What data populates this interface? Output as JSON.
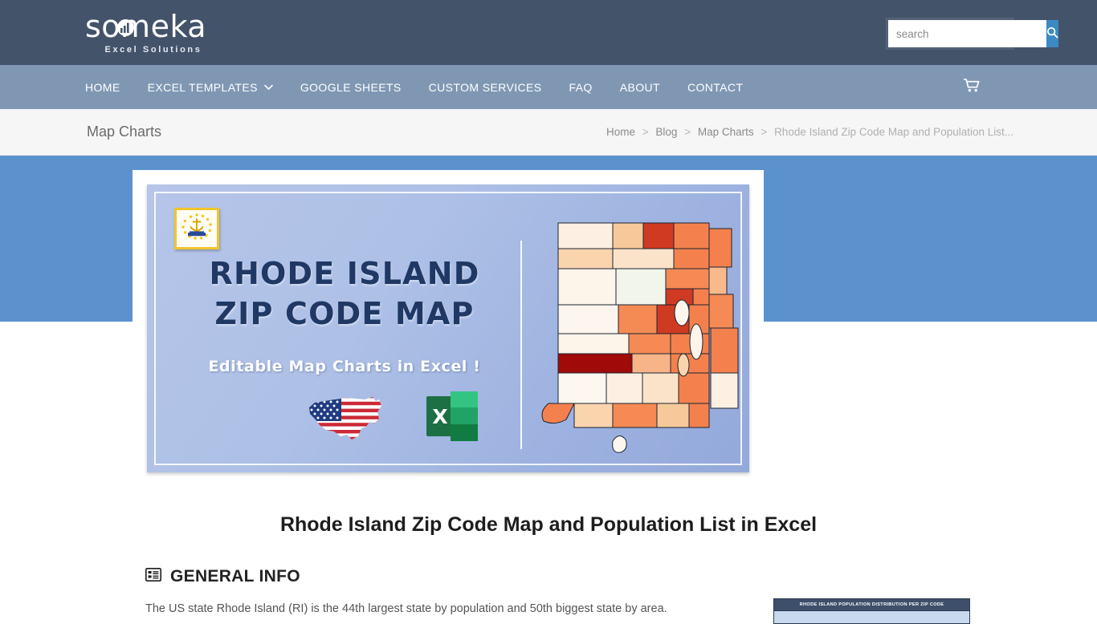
{
  "header": {
    "logo_word": "someka",
    "logo_tagline": "Excel Solutions",
    "logo_badge_icon": "bar-chart-icon"
  },
  "search": {
    "placeholder": "search",
    "value": "",
    "button_icon": "search-icon"
  },
  "nav": {
    "items": [
      {
        "label": "HOME",
        "has_dropdown": false
      },
      {
        "label": "EXCEL TEMPLATES",
        "has_dropdown": true
      },
      {
        "label": "GOOGLE SHEETS",
        "has_dropdown": false
      },
      {
        "label": "CUSTOM SERVICES",
        "has_dropdown": false
      },
      {
        "label": "FAQ",
        "has_dropdown": false
      },
      {
        "label": "ABOUT",
        "has_dropdown": false
      },
      {
        "label": "CONTACT",
        "has_dropdown": false
      }
    ],
    "cart_icon": "shopping-cart-icon",
    "dropdown_icon": "chevron-down-icon"
  },
  "breadcrumb": {
    "page_label": "Map Charts",
    "trail": [
      "Home",
      "Blog",
      "Map Charts"
    ],
    "current": "Rhode Island Zip Code Map and Population List...",
    "separator": ">"
  },
  "hero": {
    "flag_alt": "rhode-island-flag",
    "title_line1": "RHODE ISLAND",
    "title_line2": "ZIP CODE MAP",
    "subtitle": "Editable Map Charts in Excel !",
    "usa_flag_icon": "usa-flag-map-icon",
    "excel_icon": "excel-logo-icon",
    "excel_letter": "X",
    "map_alt": "rhode-island-zip-code-choropleth-map"
  },
  "article": {
    "title": "Rhode Island Zip Code Map and Population List in Excel",
    "section_icon": "list-box-icon",
    "section_title": "GENERAL INFO",
    "paragraph": "The US state Rhode Island (RI) is the 44th largest state by population and 50th biggest state by area."
  },
  "mini_chart": {
    "title": "RHODE ISLAND POPULATION DISTRIBUTION PER ZIP CODE"
  },
  "colors": {
    "header_bg": "#43536a",
    "nav_bg": "#8097b4",
    "band_bg": "#5b92ce",
    "accent_blue": "#3b8ac4",
    "hero_navy": "#1f3864",
    "excel_green": "#1d7044"
  }
}
